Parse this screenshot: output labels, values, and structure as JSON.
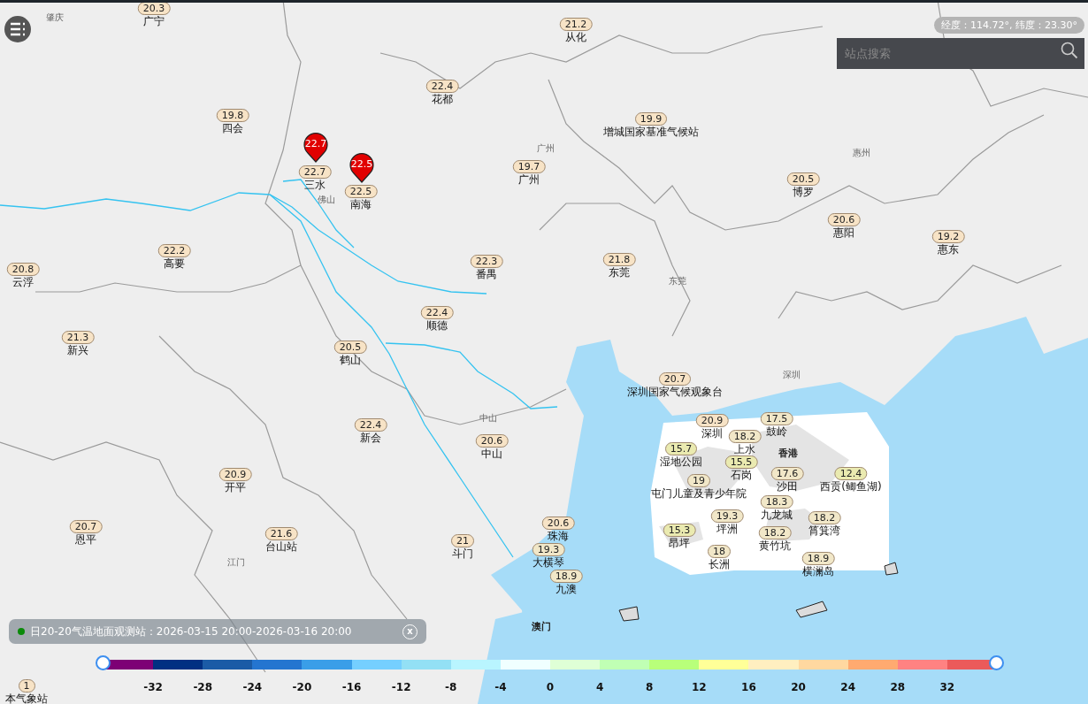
{
  "coordinates": "经度：114.72°, 纬度：23.30°",
  "search": {
    "placeholder": "站点搜索"
  },
  "places": [
    {
      "name": "肇庆",
      "kind": "city"
    },
    {
      "name": "广州",
      "kind": "city"
    },
    {
      "name": "佛山",
      "kind": "city"
    },
    {
      "name": "惠州",
      "kind": "city"
    },
    {
      "name": "东莞",
      "kind": "city"
    },
    {
      "name": "深圳",
      "kind": "city"
    },
    {
      "name": "中山",
      "kind": "city"
    },
    {
      "name": "江门",
      "kind": "city"
    },
    {
      "name": "香港",
      "kind": "district"
    },
    {
      "name": "澳门",
      "kind": "district"
    }
  ],
  "pins": [
    {
      "value": "22.7"
    },
    {
      "value": "22.5"
    }
  ],
  "stations": [
    {
      "value": "20.3",
      "name": "广宁",
      "color": "#f7e3c6"
    },
    {
      "value": "21.2",
      "name": "从化",
      "color": "#f7e3c6"
    },
    {
      "value": "22.4",
      "name": "花都",
      "color": "#f7e3c6"
    },
    {
      "value": "19.8",
      "name": "四会",
      "color": "#f7e3c6"
    },
    {
      "value": "19.9",
      "name": "增城国家基准气候站",
      "color": "#f7e3c6"
    },
    {
      "value": "22.7",
      "name": "三水",
      "color": "#f7e3c6"
    },
    {
      "value": "22.5",
      "name": "南海",
      "color": "#f7e3c6"
    },
    {
      "value": "19.7",
      "name": "广州",
      "color": "#f7e3c6"
    },
    {
      "value": "20.5",
      "name": "博罗",
      "color": "#f7e3c6"
    },
    {
      "value": "20.6",
      "name": "惠阳",
      "color": "#f7e3c6"
    },
    {
      "value": "19.2",
      "name": "惠东",
      "color": "#f7e3c6"
    },
    {
      "value": "22.2",
      "name": "高要",
      "color": "#f7e3c6"
    },
    {
      "value": "20.8",
      "name": "云浮",
      "color": "#f7e3c6"
    },
    {
      "value": "22.3",
      "name": "番禺",
      "color": "#f7e3c6"
    },
    {
      "value": "21.8",
      "name": "东莞",
      "color": "#f7e3c6"
    },
    {
      "value": "22.4",
      "name": "顺德",
      "color": "#f7e3c6"
    },
    {
      "value": "21.3",
      "name": "新兴",
      "color": "#f7e3c6"
    },
    {
      "value": "20.5",
      "name": "鹤山",
      "color": "#f7e3c6"
    },
    {
      "value": "20.7",
      "name": "深圳国家气候观象台",
      "color": "#f7e3c6"
    },
    {
      "value": "22.4",
      "name": "新会",
      "color": "#f7e3c6"
    },
    {
      "value": "20.6",
      "name": "中山",
      "color": "#f7e3c6"
    },
    {
      "value": "20.9",
      "name": "开平",
      "color": "#f7e3c6"
    },
    {
      "value": "20.7",
      "name": "恩平",
      "color": "#f7e3c6"
    },
    {
      "value": "21.6",
      "name": "台山站",
      "color": "#f7e3c6"
    },
    {
      "value": "21",
      "name": "斗门",
      "color": "#f7e3c6"
    },
    {
      "value": "20.6",
      "name": "珠海",
      "color": "#f7e3c6"
    },
    {
      "value": "19.3",
      "name": "大横琴",
      "color": "#f1e7c8"
    },
    {
      "value": "18.9",
      "name": "九澳",
      "color": "#f1e7c8"
    },
    {
      "value": "20.9",
      "name": "深圳",
      "color": "#f7e3c6"
    },
    {
      "value": "17.5",
      "name": "鼓岭",
      "color": "#f1e7c8"
    },
    {
      "value": "18.2",
      "name": "上水",
      "color": "#f1e7c8"
    },
    {
      "value": "15.7",
      "name": "湿地公园",
      "color": "#eaeab0"
    },
    {
      "value": "15.5",
      "name": "石岗",
      "color": "#eaeab0"
    },
    {
      "value": "19",
      "name": "屯门儿童及青少年院",
      "color": "#f1e7c8"
    },
    {
      "value": "17.6",
      "name": "沙田",
      "color": "#f1e7c8"
    },
    {
      "value": "12.4",
      "name": "西贡(鲫鱼湖)",
      "color": "#eaeab0"
    },
    {
      "value": "18.3",
      "name": "九龙城",
      "color": "#f1e7c8"
    },
    {
      "value": "19.3",
      "name": "坪洲",
      "color": "#f1e7c8"
    },
    {
      "value": "18.2",
      "name": "筲箕湾",
      "color": "#f1e7c8"
    },
    {
      "value": "15.3",
      "name": "昂坪",
      "color": "#eaeab0"
    },
    {
      "value": "18.2",
      "name": "黄竹坑",
      "color": "#f1e7c8"
    },
    {
      "value": "18",
      "name": "长洲",
      "color": "#f1e7c8"
    },
    {
      "value": "18.9",
      "name": "横澜岛",
      "color": "#f1e7c8"
    },
    {
      "value": "1",
      "name": "本气象站",
      "color": "#f7e3c6"
    }
  ],
  "info_bar": {
    "text": "日20-20气温地面观测站：2026-03-15 20:00-2026-03-16 20:00",
    "close": "x"
  },
  "legend": {
    "segments": [
      {
        "color": "#7d0075"
      },
      {
        "color": "#003082"
      },
      {
        "color": "#1b5ba6"
      },
      {
        "color": "#2475d0"
      },
      {
        "color": "#3a9ee8"
      },
      {
        "color": "#75cfff"
      },
      {
        "color": "#93e0f5"
      },
      {
        "color": "#b9f5ff"
      },
      {
        "color": "#f0ffff"
      },
      {
        "color": "#dfffd6"
      },
      {
        "color": "#c0ffb4"
      },
      {
        "color": "#b8ff7a"
      },
      {
        "color": "#ffff98"
      },
      {
        "color": "#ffefc0"
      },
      {
        "color": "#ffd8a0"
      },
      {
        "color": "#ffaa70"
      },
      {
        "color": "#ff8282"
      },
      {
        "color": "#eb5a5a"
      }
    ],
    "ticks": [
      "-32",
      "-28",
      "-24",
      "-20",
      "-16",
      "-12",
      "-8",
      "-4",
      "0",
      "4",
      "8",
      "12",
      "16",
      "20",
      "24",
      "28",
      "32"
    ],
    "handles": [
      {
        "level": 0
      },
      {
        "level": 1
      }
    ]
  }
}
